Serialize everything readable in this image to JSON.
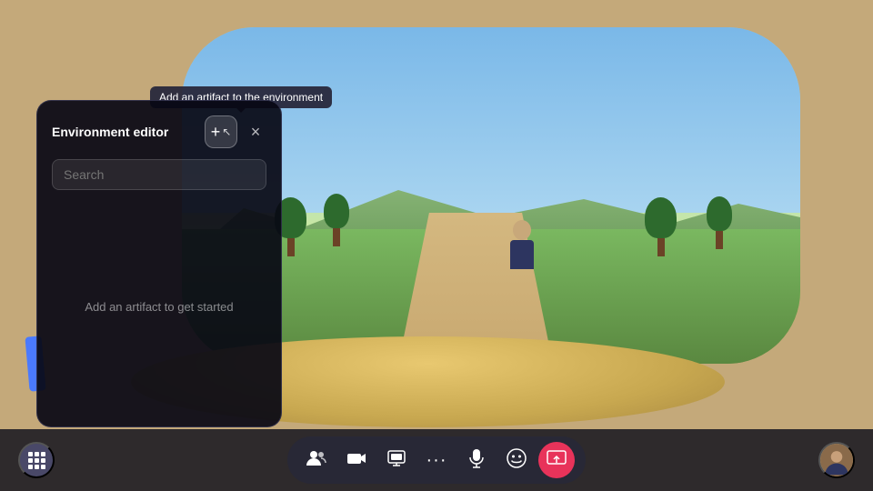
{
  "scene": {
    "background_color": "#c4a97a"
  },
  "tooltip": {
    "text": "Add an artifact to the environment"
  },
  "panel": {
    "title": "Environment editor",
    "search_placeholder": "Search",
    "empty_message": "Add an artifact to get started",
    "add_button_label": "+",
    "close_button_label": "×"
  },
  "toolbar": {
    "grid_icon": "⊞",
    "people_icon": "👥",
    "camera_icon": "🎥",
    "present_icon": "📋",
    "more_icon": "•••",
    "mic_icon": "🎤",
    "emoji_icon": "😊",
    "share_icon": "📤",
    "avatar_label": "Avatar"
  }
}
